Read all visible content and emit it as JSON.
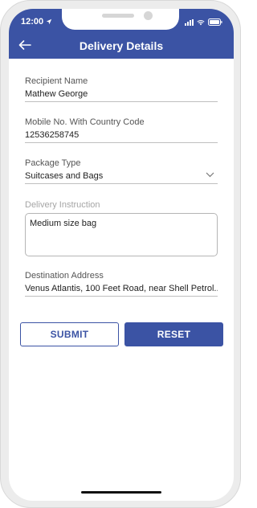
{
  "status_bar": {
    "time": "12:00"
  },
  "header": {
    "title": "Delivery Details",
    "back_icon": "arrow-left-icon"
  },
  "form": {
    "recipient_name": {
      "label": "Recipient Name",
      "value": "Mathew George"
    },
    "mobile": {
      "label": "Mobile No. With Country Code",
      "value": "12536258745"
    },
    "package_type": {
      "label": "Package Type",
      "value": "Suitcases and Bags",
      "icon": "chevron-down-icon"
    },
    "delivery_instruction": {
      "label": "Delivery Instruction",
      "value": "Medium size bag"
    },
    "destination_address": {
      "label": "Destination Address",
      "value": "Venus Atlantis, 100 Feet Road, near Shell Petrol..."
    }
  },
  "actions": {
    "submit_label": "SUBMIT",
    "reset_label": "RESET"
  },
  "colors": {
    "primary": "#3b53a4",
    "text": "#222222",
    "label": "#555555",
    "muted_label": "#a5a5a5"
  }
}
